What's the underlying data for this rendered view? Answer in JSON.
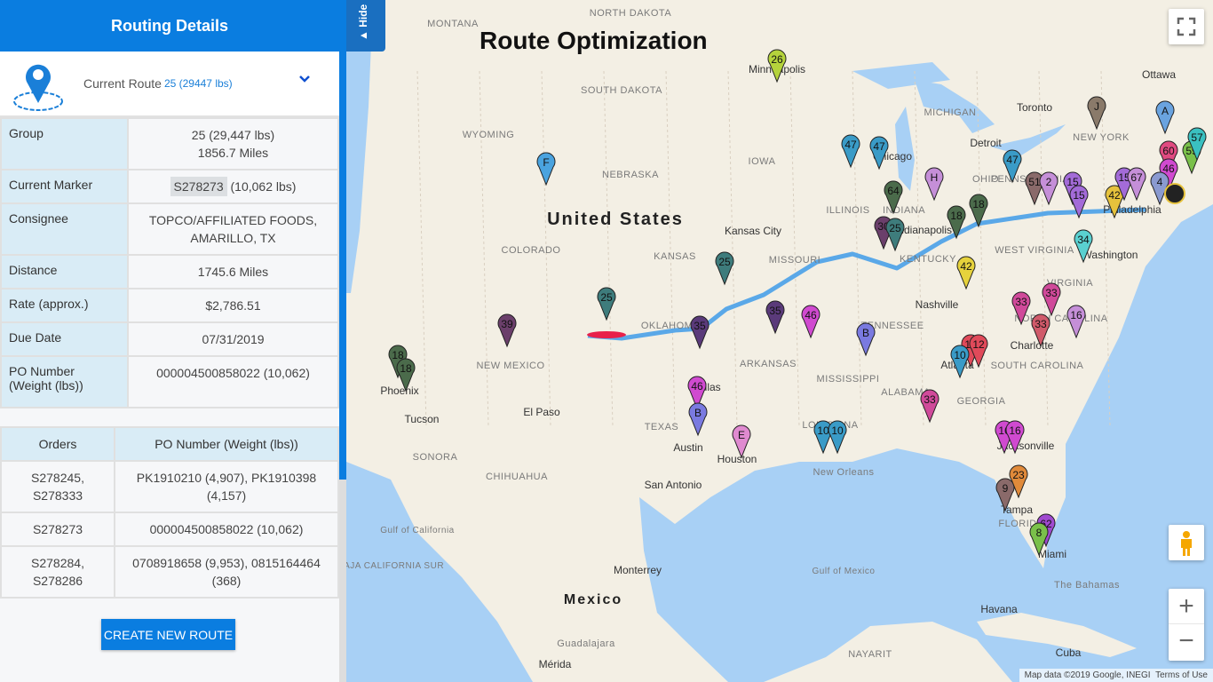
{
  "panel": {
    "title": "Routing Details",
    "current_route_label": "Current Route",
    "current_route_value": "25 (29447 lbs)",
    "details": [
      {
        "key": "Group",
        "value": [
          "25 (29,447 lbs)",
          "1856.7 Miles"
        ]
      },
      {
        "key": "Current Marker",
        "tag": "S278273",
        "value": [
          "(10,062 lbs)"
        ]
      },
      {
        "key": "Consignee",
        "value": [
          "TOPCO/AFFILIATED FOODS,",
          "AMARILLO, TX"
        ]
      },
      {
        "key": "Distance",
        "value": [
          "1745.6 Miles"
        ]
      },
      {
        "key": "Rate (approx.)",
        "value": [
          "$2,786.51"
        ]
      },
      {
        "key": "Due Date",
        "value": [
          "07/31/2019"
        ]
      },
      {
        "key": "PO Number (Weight (lbs))",
        "value": [
          "000004500858022 (10,062)"
        ]
      }
    ],
    "orders": {
      "headers": [
        "Orders",
        "PO Number (Weight (lbs))"
      ],
      "rows": [
        [
          "S278245, S278333",
          "PK1910210 (4,907), PK1910398 (4,157)"
        ],
        [
          "S278273",
          "000004500858022 (10,062)"
        ],
        [
          "S278284, S278286",
          "0708918658 (9,953), 0815164464 (368)"
        ]
      ]
    },
    "create_button": "CREATE NEW ROUTE"
  },
  "map": {
    "hide_label": "▲ Hide",
    "title": "Route Optimization",
    "attribution": "Map data ©2019 Google, INEGI",
    "terms": "Terms of Use",
    "zoom_in": "+",
    "zoom_out": "−",
    "route_color": "#5aa8e8",
    "selected_color": "#e8204a",
    "labels": [
      "United States",
      "Mexico",
      "NORTH DAKOTA",
      "MONTANA",
      "SOUTH DAKOTA",
      "WYOMING",
      "NEBRASKA",
      "IOWA",
      "ILLINOIS",
      "INDIANA",
      "OHIO",
      "MICHIGAN",
      "NEW YORK",
      "PENNSYLVANIA",
      "COLORADO",
      "KANSAS",
      "MISSOURI",
      "KENTUCKY",
      "WEST VIRGINIA",
      "VIRGINIA",
      "TENNESSEE",
      "NORTH CAROLINA",
      "SOUTH CAROLINA",
      "GEORGIA",
      "ALABAMA",
      "MISSISSIPPI",
      "ARKANSAS",
      "OKLAHOMA",
      "TEXAS",
      "NEW MEXICO",
      "LOUISIANA",
      "FLORIDA",
      "SONORA",
      "CHIHUAHUA",
      "Minneapolis",
      "Chicago",
      "Detroit",
      "Toronto",
      "Ottawa",
      "Kansas City",
      "Indianapolis",
      "Philadelphia",
      "Washington",
      "Nashville",
      "Charlotte",
      "Atlanta",
      "Jacksonville",
      "Tampa",
      "Miami",
      "Dallas",
      "Austin",
      "Houston",
      "San Antonio",
      "New Orleans",
      "El Paso",
      "Tucson",
      "Phoenix",
      "Monterrey",
      "Havana",
      "Cuba",
      "The Bahamas",
      "Gulf of Mexico",
      "Guadalajara",
      "Mérida",
      "NAYARIT",
      "BAJA CALIFORNIA SUR",
      "Gulf of California"
    ],
    "markers": [
      {
        "l": "26",
        "c": "#b5d33c"
      },
      {
        "l": "F",
        "c": "#4aa3df"
      },
      {
        "l": "47",
        "c": "#3a9bc7"
      },
      {
        "l": "47",
        "c": "#3a9bc7"
      },
      {
        "l": "64",
        "c": "#4b6b4b"
      },
      {
        "l": "H",
        "c": "#c58fd8"
      },
      {
        "l": "18",
        "c": "#4b6b4b"
      },
      {
        "l": "18",
        "c": "#4b6b4b"
      },
      {
        "l": "30",
        "c": "#6b3f6b"
      },
      {
        "l": "25",
        "c": "#3e7c7c"
      },
      {
        "l": "42",
        "c": "#e6d23c"
      },
      {
        "l": "47",
        "c": "#3a9bc7"
      },
      {
        "l": "51",
        "c": "#8a6a6a"
      },
      {
        "l": "2",
        "c": "#c58fd8"
      },
      {
        "l": "15",
        "c": "#a36bd8"
      },
      {
        "l": "15",
        "c": "#a36bd8"
      },
      {
        "l": "42",
        "c": "#e6c23c"
      },
      {
        "l": "J",
        "c": "#8a7a6a"
      },
      {
        "l": "A",
        "c": "#6aa3df"
      },
      {
        "l": "60",
        "c": "#e04a80"
      },
      {
        "l": "46",
        "c": "#d04ad0"
      },
      {
        "l": "59",
        "c": "#7ac04a"
      },
      {
        "l": "57",
        "c": "#3ac0c0"
      },
      {
        "l": "15",
        "c": "#a36bd8"
      },
      {
        "l": "67",
        "c": "#c58fd8"
      },
      {
        "l": "4",
        "c": "#8a9ad0"
      },
      {
        "l": "34",
        "c": "#5ad0d0"
      },
      {
        "l": "33",
        "c": "#d04a9a"
      },
      {
        "l": "33",
        "c": "#d04a9a"
      },
      {
        "l": "33",
        "c": "#d05a6a"
      },
      {
        "l": "16",
        "c": "#c58fd8"
      },
      {
        "l": "B",
        "c": "#7a7ae0"
      },
      {
        "l": "12",
        "c": "#e04a5a"
      },
      {
        "l": "12",
        "c": "#e04a5a"
      },
      {
        "l": "10",
        "c": "#3a9bc7"
      },
      {
        "l": "33",
        "c": "#d04a9a"
      },
      {
        "l": "16",
        "c": "#d04ad0"
      },
      {
        "l": "16",
        "c": "#d04ad0"
      },
      {
        "l": "9",
        "c": "#8a6a6a"
      },
      {
        "l": "23",
        "c": "#e08a3a"
      },
      {
        "l": "62",
        "c": "#a04ad0"
      },
      {
        "l": "8",
        "c": "#7ac04a"
      },
      {
        "l": "10",
        "c": "#3a9bc7"
      },
      {
        "l": "10",
        "c": "#3a9bc7"
      },
      {
        "l": "E",
        "c": "#e08ad0"
      },
      {
        "l": "46",
        "c": "#d04ad0"
      },
      {
        "l": "B",
        "c": "#7a7ae0"
      },
      {
        "l": "35",
        "c": "#5a3a7a"
      },
      {
        "l": "35",
        "c": "#5a3a7a"
      },
      {
        "l": "46",
        "c": "#d04ad0"
      },
      {
        "l": "25",
        "c": "#3e7c7c"
      },
      {
        "l": "25",
        "c": "#3e7c7c"
      },
      {
        "l": "39",
        "c": "#6b3f6b"
      },
      {
        "l": "18",
        "c": "#4b6b4b"
      },
      {
        "l": "18",
        "c": "#4b6b4b"
      }
    ]
  }
}
